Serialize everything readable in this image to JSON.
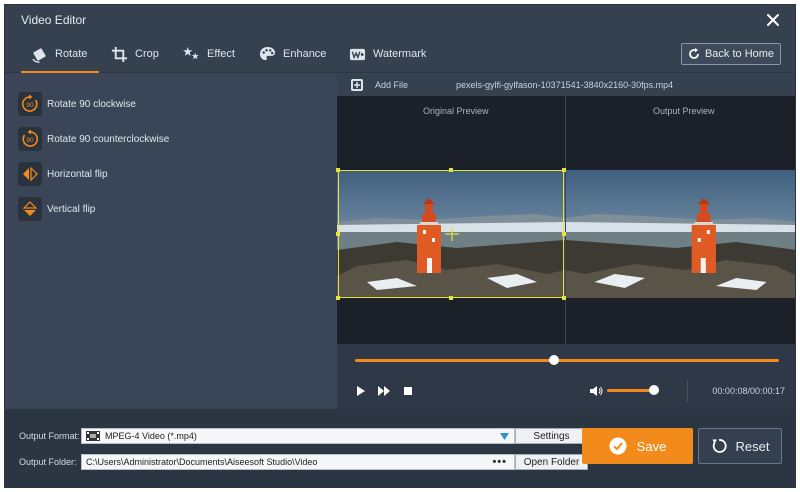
{
  "window": {
    "title": "Video Editor"
  },
  "tabs": [
    {
      "label": "Rotate",
      "icon": "rotate-icon",
      "active": true
    },
    {
      "label": "Crop",
      "icon": "crop-icon"
    },
    {
      "label": "Effect",
      "icon": "effect-icon"
    },
    {
      "label": "Enhance",
      "icon": "enhance-icon"
    },
    {
      "label": "Watermark",
      "icon": "watermark-icon"
    }
  ],
  "back_button": "Back to Home",
  "rotate_options": [
    {
      "label": "Rotate 90 clockwise",
      "icon": "rotate-clockwise-icon"
    },
    {
      "label": "Rotate 90 counterclockwise",
      "icon": "rotate-counterclockwise-icon"
    },
    {
      "label": "Horizontal flip",
      "icon": "horizontal-flip-icon"
    },
    {
      "label": "Vertical flip",
      "icon": "vertical-flip-icon"
    }
  ],
  "rotate_badge": "90",
  "file": {
    "add_label": "Add File",
    "name": "pexels-gylfi-gylfason-10371541-3840x2160-30fps.mp4"
  },
  "preview": {
    "original_label": "Original Preview",
    "output_label": "Output Preview"
  },
  "playback": {
    "position_fraction": 0.47,
    "volume_fraction": 0.9,
    "time": "00:00:08/00:00:17"
  },
  "output": {
    "format_label": "Output Format:",
    "format_value": "MPEG-4 Video (*.mp4)",
    "folder_label": "Output Folder:",
    "folder_value": "C:\\Users\\Administrator\\Documents\\Aiseesoft Studio\\Video",
    "settings_button": "Settings",
    "open_folder_button": "Open Folder",
    "save_button": "Save",
    "reset_button": "Reset"
  },
  "colors": {
    "accent": "#f28b1c",
    "crop_frame": "#e3e33c",
    "panel": "#3a4657"
  }
}
